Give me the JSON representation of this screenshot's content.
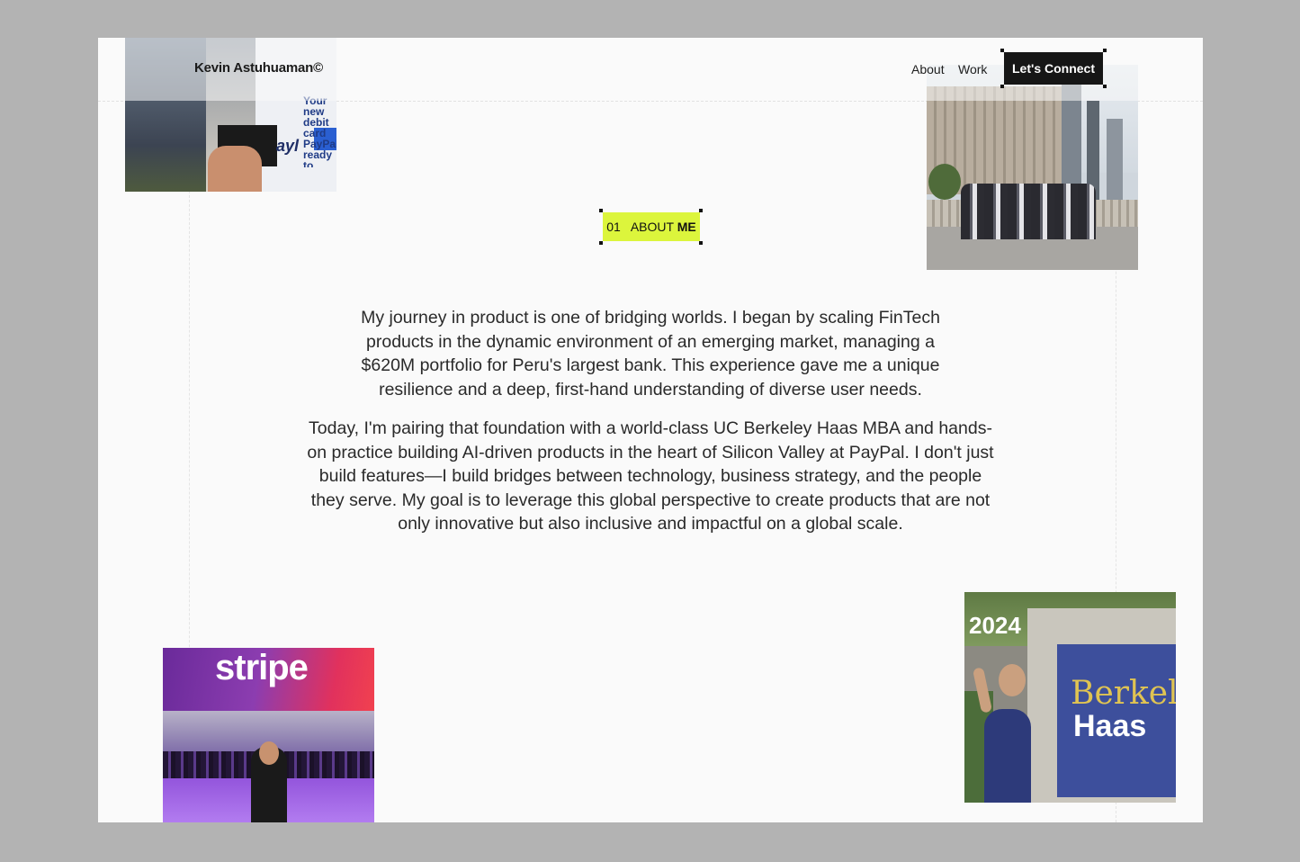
{
  "header": {
    "brand": "Kevin Astuhuaman©",
    "nav": [
      "About",
      "Work"
    ],
    "cta": "Let's Connect"
  },
  "section": {
    "number": "01",
    "label_regular": "ABOUT",
    "label_bold": "ME",
    "accent_color": "#dcf53c"
  },
  "about": {
    "paragraph_1": "My journey in product is one of bridging worlds. I began by scaling FinTech products in the dynamic environment of an emerging market, managing a $620M portfolio for Peru's largest bank. This experience gave me a unique resilience and a deep, first-hand understanding of diverse user needs.",
    "paragraph_2": "Today, I'm pairing that foundation with a world-class UC Berkeley Haas MBA and hands-on practice building AI-driven products in the heart of Silicon Valley at PayPal. I don't just build features—I build bridges between technology, business strategy, and the people they serve. My goal is to leverage this global perspective to create products that are not only innovative but also inclusive and impactful on a global scale."
  },
  "photos": {
    "paypal": {
      "text": "Your new debit card PayPal ready to reward"
    },
    "stripe": {
      "logo": "stripe"
    },
    "haas": {
      "year": "2024",
      "sign_top": "Berkeley",
      "sign_bottom": "Haas"
    }
  }
}
